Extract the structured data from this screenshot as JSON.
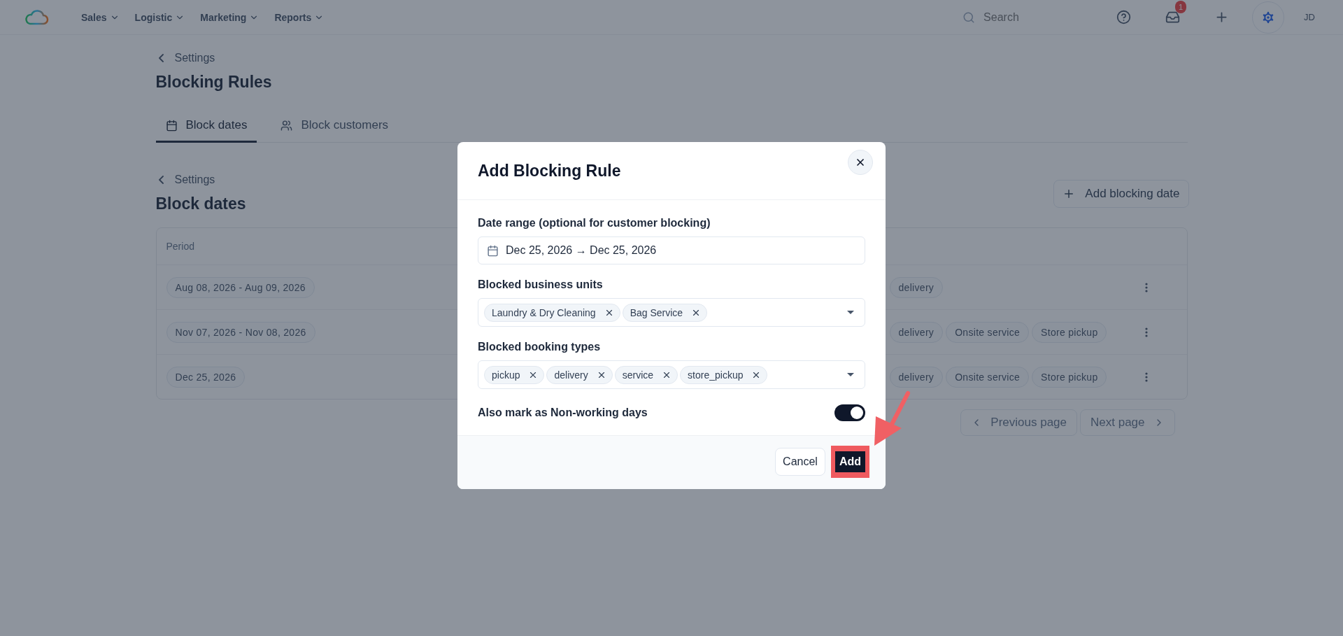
{
  "topbar": {
    "nav": [
      {
        "label": "Sales"
      },
      {
        "label": "Logistic"
      },
      {
        "label": "Marketing"
      },
      {
        "label": "Reports"
      }
    ],
    "search": {
      "placeholder": "Search"
    },
    "notification_count": "1",
    "user_initials": "JD"
  },
  "page": {
    "breadcrumb": "Settings",
    "title": "Blocking Rules",
    "tabs": [
      {
        "label": "Block dates",
        "selected": true,
        "kind": "calendar"
      },
      {
        "label": "Block customers",
        "selected": false,
        "kind": "users"
      }
    ],
    "section": {
      "breadcrumb": "Settings",
      "title": "Block dates",
      "add_button": "Add blocking date"
    },
    "table": {
      "columns": [
        "Period"
      ],
      "rows": [
        {
          "period": "Aug 08, 2026 - Aug 09, 2026",
          "booking_types": [
            "delivery"
          ]
        },
        {
          "period": "Nov 07, 2026 - Nov 08, 2026",
          "booking_types": [
            "delivery",
            "Onsite service",
            "Store pickup"
          ]
        },
        {
          "period": "Dec 25, 2026",
          "booking_types": [
            "delivery",
            "Onsite service",
            "Store pickup"
          ]
        }
      ]
    },
    "pagination": {
      "previous": "Previous page",
      "next": "Next page"
    }
  },
  "dialog": {
    "title": "Add Blocking Rule",
    "date_range": {
      "label": "Date range (optional for customer blocking)",
      "value": "Dec 25, 2026 → Dec 25, 2026"
    },
    "business_units": {
      "label": "Blocked business units",
      "tags": [
        "Laundry & Dry Cleaning",
        "Bag Service"
      ]
    },
    "booking_types": {
      "label": "Blocked booking types",
      "tags": [
        "pickup",
        "delivery",
        "service",
        "store_pickup"
      ]
    },
    "non_working": {
      "label": "Also mark as Non-working days",
      "on": true
    },
    "buttons": {
      "cancel": "Cancel",
      "add": "Add"
    }
  }
}
